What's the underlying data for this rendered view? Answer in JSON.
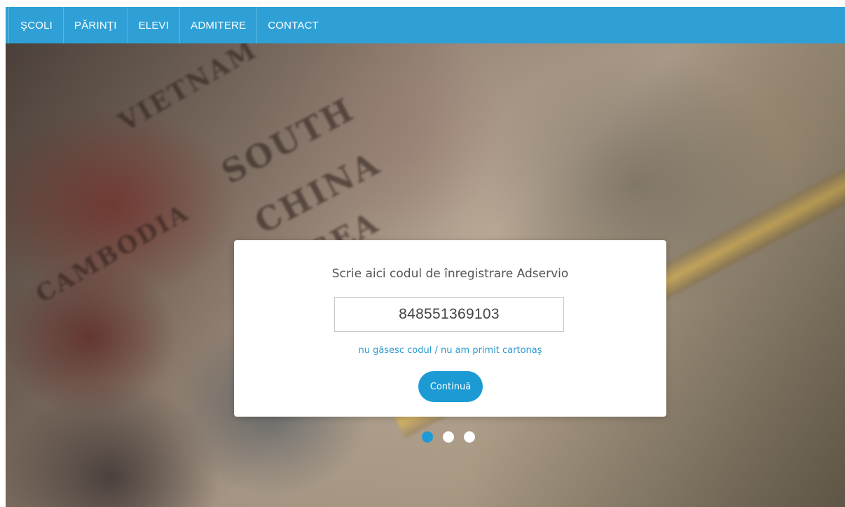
{
  "nav": {
    "items": [
      {
        "label": "ŞCOLI"
      },
      {
        "label": "PĂRINŢI"
      },
      {
        "label": "ELEVI"
      },
      {
        "label": "ADMITERE"
      },
      {
        "label": "CONTACT"
      }
    ]
  },
  "hero": {
    "map_words": [
      "SOUTH",
      "CHINA",
      "SEA",
      "VIETNAM",
      "CAMBODIA"
    ]
  },
  "form": {
    "heading": "Scrie aici codul de înregistrare Adservio",
    "code_value": "848551369103",
    "help_link": "nu găsesc codul / nu am primit cartonaş",
    "continue_label": "Continuă"
  },
  "carousel": {
    "slide_count": 3,
    "active_index": 0
  },
  "colors": {
    "nav_background": "#2ea0d6",
    "accent": "#1b9ad4",
    "link": "#2c9bd2"
  }
}
